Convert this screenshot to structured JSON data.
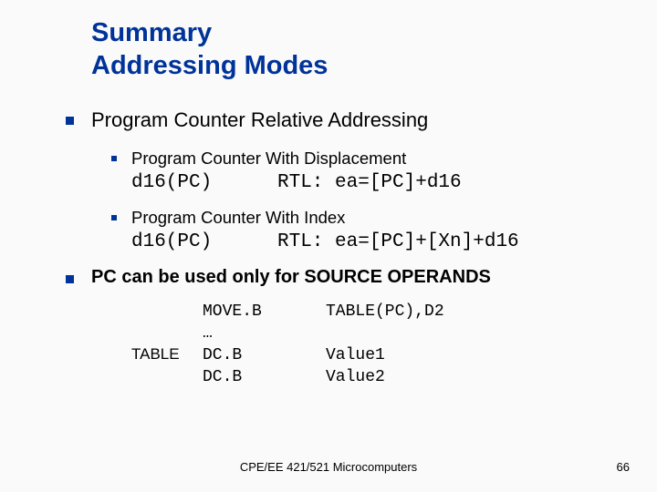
{
  "title_line1": "Summary",
  "title_line2": "Addressing Modes",
  "h1": "Program Counter Relative Addressing",
  "mode1": {
    "heading": "Program Counter With Displacement",
    "syntax": "d16(PC)",
    "rtl": "RTL: ea=[PC]+d16"
  },
  "mode2": {
    "heading": "Program Counter With Index",
    "syntax": "d16(PC)",
    "rtl": "RTL: ea=[PC]+[Xn]+d16"
  },
  "note": "PC can be used only for SOURCE OPERANDS",
  "example": {
    "rows": [
      {
        "label": "",
        "op": "MOVE.B",
        "arg": "TABLE(PC),D2"
      },
      {
        "label": "",
        "op": "…",
        "arg": ""
      },
      {
        "label": "TABLE",
        "op": "DC.B",
        "arg": "Value1"
      },
      {
        "label": "",
        "op": "DC.B",
        "arg": "Value2"
      }
    ]
  },
  "footer": "CPE/EE 421/521 Microcomputers",
  "page": "66"
}
